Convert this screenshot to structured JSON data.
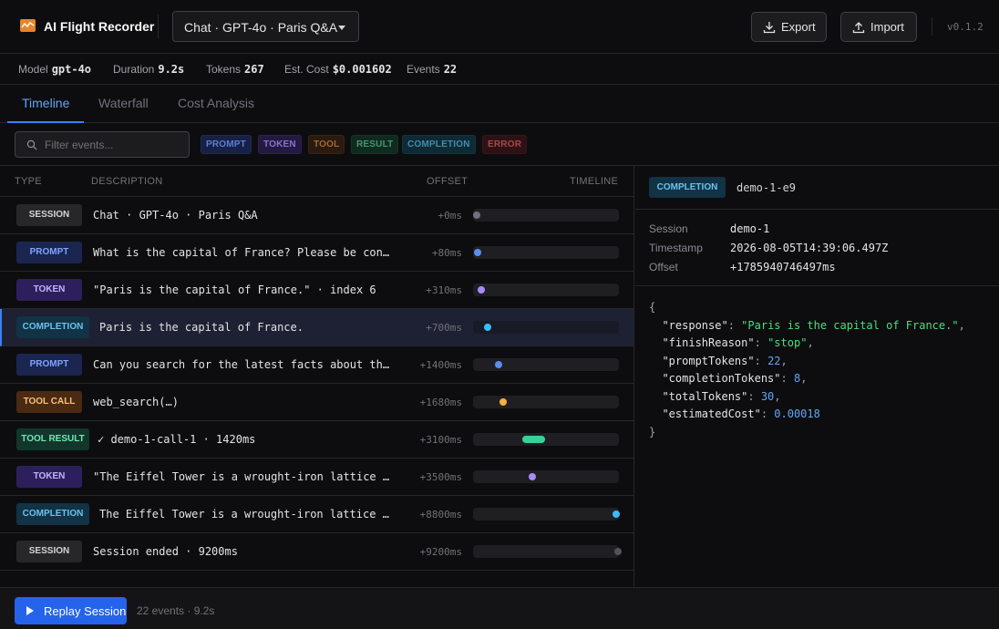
{
  "app": {
    "title": "AI Flight Recorder",
    "version": "v0.1.2"
  },
  "header": {
    "session_select": "Chat · GPT-4o · Paris Q&A",
    "export_label": "Export",
    "import_label": "Import"
  },
  "stats": [
    {
      "label": "Model",
      "value": "gpt-4o"
    },
    {
      "label": "Duration",
      "value": "9.2s"
    },
    {
      "label": "Tokens",
      "value": "267"
    },
    {
      "label": "Est. Cost",
      "value": "$0.001602"
    },
    {
      "label": "Events",
      "value": "22"
    }
  ],
  "tabs": [
    "Timeline",
    "Waterfall",
    "Cost Analysis"
  ],
  "active_tab": "Timeline",
  "filter": {
    "placeholder": "Filter events...",
    "chips": [
      "PROMPT",
      "TOKEN",
      "TOOL",
      "RESULT",
      "COMPLETION",
      "ERROR"
    ]
  },
  "table": {
    "headers": {
      "type": "TYPE",
      "description": "DESCRIPTION",
      "offset": "OFFSET",
      "timeline": "TIMELINE"
    },
    "rows": [
      {
        "type": "SESSION",
        "description": "Chat · GPT-4o · Paris Q&A",
        "offset": "+0ms"
      },
      {
        "type": "PROMPT",
        "description": "What is the capital of France? Please be concise.",
        "offset": "+80ms"
      },
      {
        "type": "TOKEN",
        "description": "\"Paris is the capital of France.\" · index 6",
        "offset": "+310ms"
      },
      {
        "type": "COMPLETION",
        "description": "Paris is the capital of France.",
        "offset": "+700ms"
      },
      {
        "type": "PROMPT",
        "description": "Can you search for the latest facts about the Ei…",
        "offset": "+1400ms"
      },
      {
        "type": "TOOL CALL",
        "description": "web_search(…)",
        "offset": "+1680ms"
      },
      {
        "type": "TOOL RESULT",
        "description": "✓ demo-1-call-1 · 1420ms",
        "offset": "+3100ms"
      },
      {
        "type": "TOKEN",
        "description": "\"The Eiffel Tower is a wrought-iron lattice towe…",
        "offset": "+3500ms"
      },
      {
        "type": "COMPLETION",
        "description": "The Eiffel Tower is a wrought-iron lattice towe…",
        "offset": "+8800ms"
      },
      {
        "type": "SESSION",
        "description": "Session ended · 9200ms",
        "offset": "+9200ms"
      }
    ]
  },
  "detail": {
    "type": "COMPLETION",
    "id": "demo-1-e9",
    "meta": [
      {
        "key": "Session",
        "value": "demo-1"
      },
      {
        "key": "Timestamp",
        "value": "2026-08-05T14:39:06.497Z"
      },
      {
        "key": "Offset",
        "value": "+1785940746497ms"
      }
    ],
    "json": {
      "response": "Paris is the capital of France.",
      "finishReason": "stop",
      "promptTokens": "22",
      "completionTokens": "8",
      "totalTokens": "30",
      "estimatedCost": "0.00018"
    }
  },
  "footer": {
    "replay_label": "Replay Session",
    "info": "22 events · 9.2s"
  }
}
